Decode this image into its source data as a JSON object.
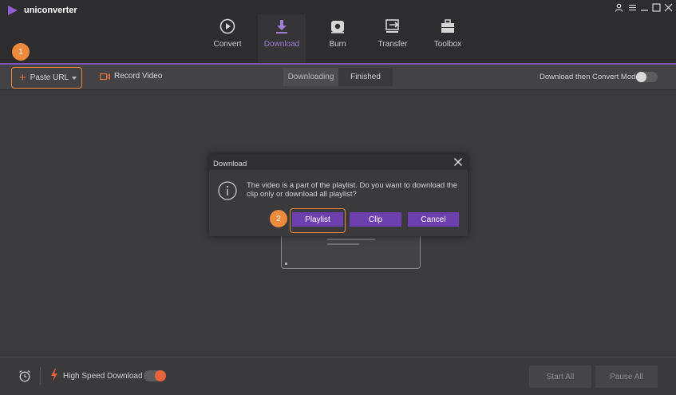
{
  "app": {
    "name": "uniconverter"
  },
  "tabs": [
    {
      "label": "Convert",
      "icon": "convert-icon",
      "active": false
    },
    {
      "label": "Download",
      "icon": "download-icon",
      "active": true
    },
    {
      "label": "Burn",
      "icon": "burn-icon",
      "active": false
    },
    {
      "label": "Transfer",
      "icon": "transfer-icon",
      "active": false
    },
    {
      "label": "Toolbox",
      "icon": "toolbox-icon",
      "active": false
    }
  ],
  "toolbar": {
    "paste_url_label": "Paste URL",
    "record_video_label": "Record Video",
    "segments": {
      "downloading": "Downloading",
      "finished": "Finished",
      "selected": "Downloading"
    },
    "mode_label": "Download then Convert Mode",
    "mode_enabled": false
  },
  "callouts": {
    "first": "1",
    "second": "2"
  },
  "dialog": {
    "title": "Download",
    "message": "The video is a part of the playlist. Do you want to download the clip only or download all playlist?",
    "buttons": {
      "playlist": "Playlist",
      "clip": "Clip",
      "cancel": "Cancel"
    }
  },
  "bottom": {
    "high_speed_label": "High Speed Download",
    "high_speed_enabled": true,
    "start_all": "Start All",
    "pause_all": "Pause All"
  },
  "colors": {
    "accent_purple": "#6e3fae",
    "highlight_orange": "#e88839",
    "toggle_on": "#e8623a",
    "background": "#3b3a3c"
  }
}
